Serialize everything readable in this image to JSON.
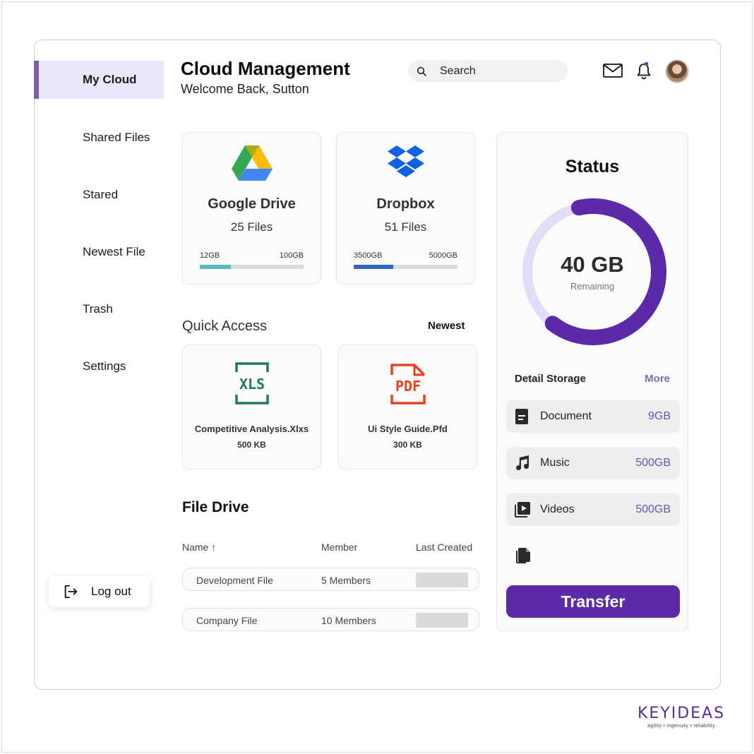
{
  "header": {
    "title": "Cloud Management",
    "subtitle": "Welcome Back, Sutton",
    "search_placeholder": "Search"
  },
  "sidebar": {
    "items": [
      {
        "label": "My Cloud",
        "active": true
      },
      {
        "label": "Shared Files"
      },
      {
        "label": "Stared"
      },
      {
        "label": "Newest File"
      },
      {
        "label": "Trash"
      },
      {
        "label": "Settings"
      }
    ],
    "logout_label": "Log out"
  },
  "storage_cards": [
    {
      "name": "Google Drive",
      "files": "25 Files",
      "used": "12GB",
      "total": "100GB",
      "used_fraction": 0.3,
      "bar_color": "#58b8c0",
      "logo": "google-drive-logo"
    },
    {
      "name": "Dropbox",
      "files": "51 Files",
      "used": "3500GB",
      "total": "5000GB",
      "used_fraction": 0.38,
      "bar_color": "#2f64c9",
      "logo": "dropbox-logo"
    }
  ],
  "quick_access": {
    "title": "Quick Access",
    "sort_label": "Newest",
    "files": [
      {
        "name": "Competitive Analysis.Xlxs",
        "size": "500 KB",
        "icon": "xls-file-icon",
        "icon_text": "XLS",
        "color": "#1f7a5a"
      },
      {
        "name": "Ui Style Guide.Pfd",
        "size": "300 KB",
        "icon": "pdf-file-icon",
        "icon_text": "PDF",
        "color": "#e8401c"
      }
    ]
  },
  "file_drive": {
    "title": "File Drive",
    "columns": {
      "name": "Name ↑",
      "member": "Member",
      "last_created": "Last Created"
    },
    "rows": [
      {
        "name": "Development File",
        "members": "5 Members"
      },
      {
        "name": "Company File",
        "members": "10 Members"
      }
    ]
  },
  "status": {
    "title": "Status",
    "remaining_value": "40 GB",
    "remaining_label": "Remaining",
    "used_fraction": 0.64,
    "ring_color": "#5a2aa8",
    "ring_track_color": "#e4dcf7",
    "detail_title": "Detail Storage",
    "more_label": "More",
    "items": [
      {
        "label": "Document",
        "value": "9GB",
        "icon": "document-icon"
      },
      {
        "label": "Music",
        "value": "500GB",
        "icon": "music-note-icon"
      },
      {
        "label": "Videos",
        "value": "500GB",
        "icon": "video-library-icon"
      }
    ],
    "transfer_label": "Transfer"
  },
  "brand": {
    "name": "KEYIDEAS",
    "tagline": "agility • ingenuity • reliability"
  }
}
